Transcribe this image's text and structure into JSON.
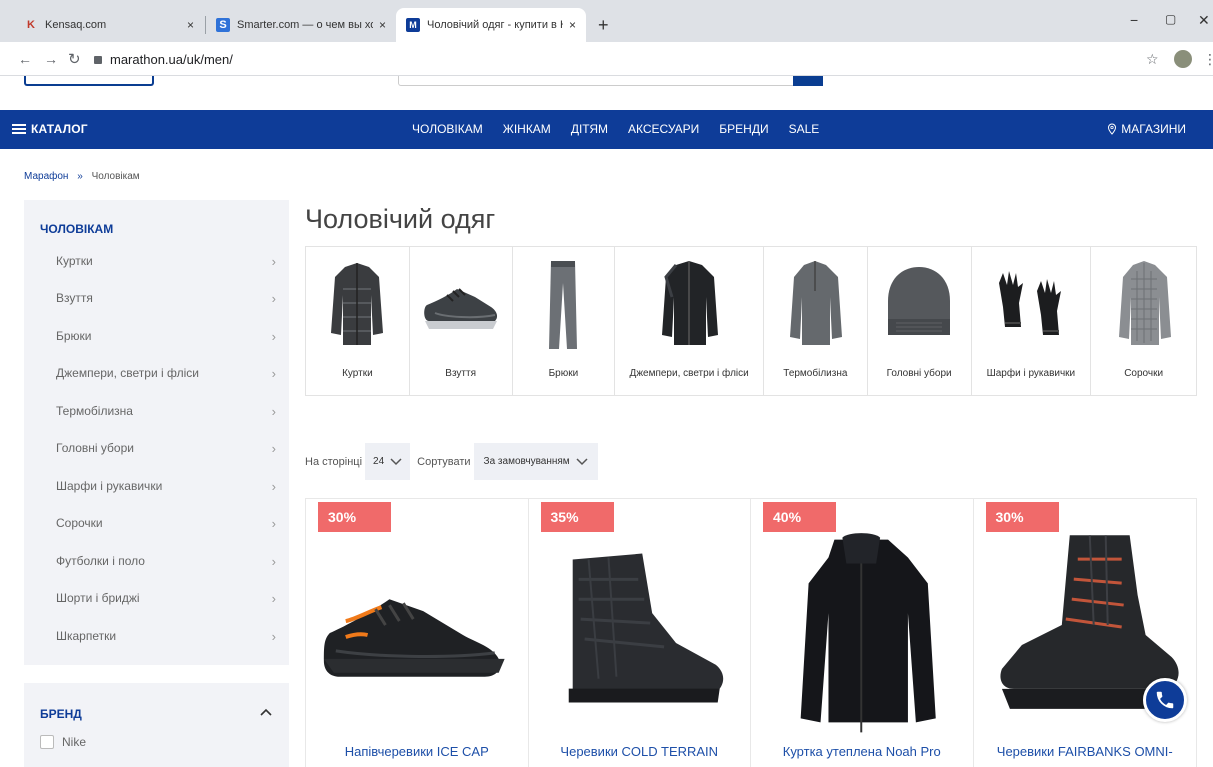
{
  "browser": {
    "tabs": [
      {
        "title": "Kensaq.com",
        "favicon": "K",
        "color": "#c0392b"
      },
      {
        "title": "Smarter.com — о чем вы хотите",
        "favicon": "S",
        "color": "#2f72d8"
      },
      {
        "title": "Чоловічий одяг - купити в Києв",
        "favicon": "M",
        "color": "#0e3c98"
      }
    ],
    "new_tab": "+",
    "close": "×",
    "url": "marathon.ua/uk/men/",
    "win_min": "−",
    "win_max": "▢",
    "win_close": "✕"
  },
  "navbar": {
    "catalog": "КАТАЛОГ",
    "links": [
      "ЧОЛОВІКАМ",
      "ЖІНКАМ",
      "ДІТЯМ",
      "АКСЕСУАРИ",
      "БРЕНДИ",
      "SALE"
    ],
    "shops": "МАГАЗИНИ"
  },
  "breadcrumb": {
    "home": "Марафон",
    "sep": "»",
    "current": "Чоловікам"
  },
  "sidebar": {
    "title": "ЧОЛОВІКАМ",
    "items": [
      "Куртки",
      "Взуття",
      "Брюки",
      "Джемпери, светри і фліси",
      "Термобілизна",
      "Головні убори",
      "Шарфи і рукавички",
      "Сорочки",
      "Футболки і поло",
      "Шорти і бриджі",
      "Шкарпетки"
    ],
    "brand_title": "БРЕНД",
    "brand_first": "Nike"
  },
  "page_title": "Чоловічий одяг",
  "categories": [
    "Куртки",
    "Взуття",
    "Брюки",
    "Джемпери, светри і фліси",
    "Термобілизна",
    "Головні убори",
    "Шарфи і рукавички",
    "Сорочки"
  ],
  "controls": {
    "per_page_label": "На сторінці",
    "per_page_value": "24",
    "sort_label": "Сортувати",
    "sort_value": "За замовчуванням"
  },
  "products": [
    {
      "discount": "30%",
      "title": "Напівчеревики ICE CAP"
    },
    {
      "discount": "35%",
      "title": "Черевики COLD TERRAIN"
    },
    {
      "discount": "40%",
      "title": "Куртка утеплена Noah Pro"
    },
    {
      "discount": "30%",
      "title": "Черевики FAIRBANKS OMNI-"
    }
  ]
}
